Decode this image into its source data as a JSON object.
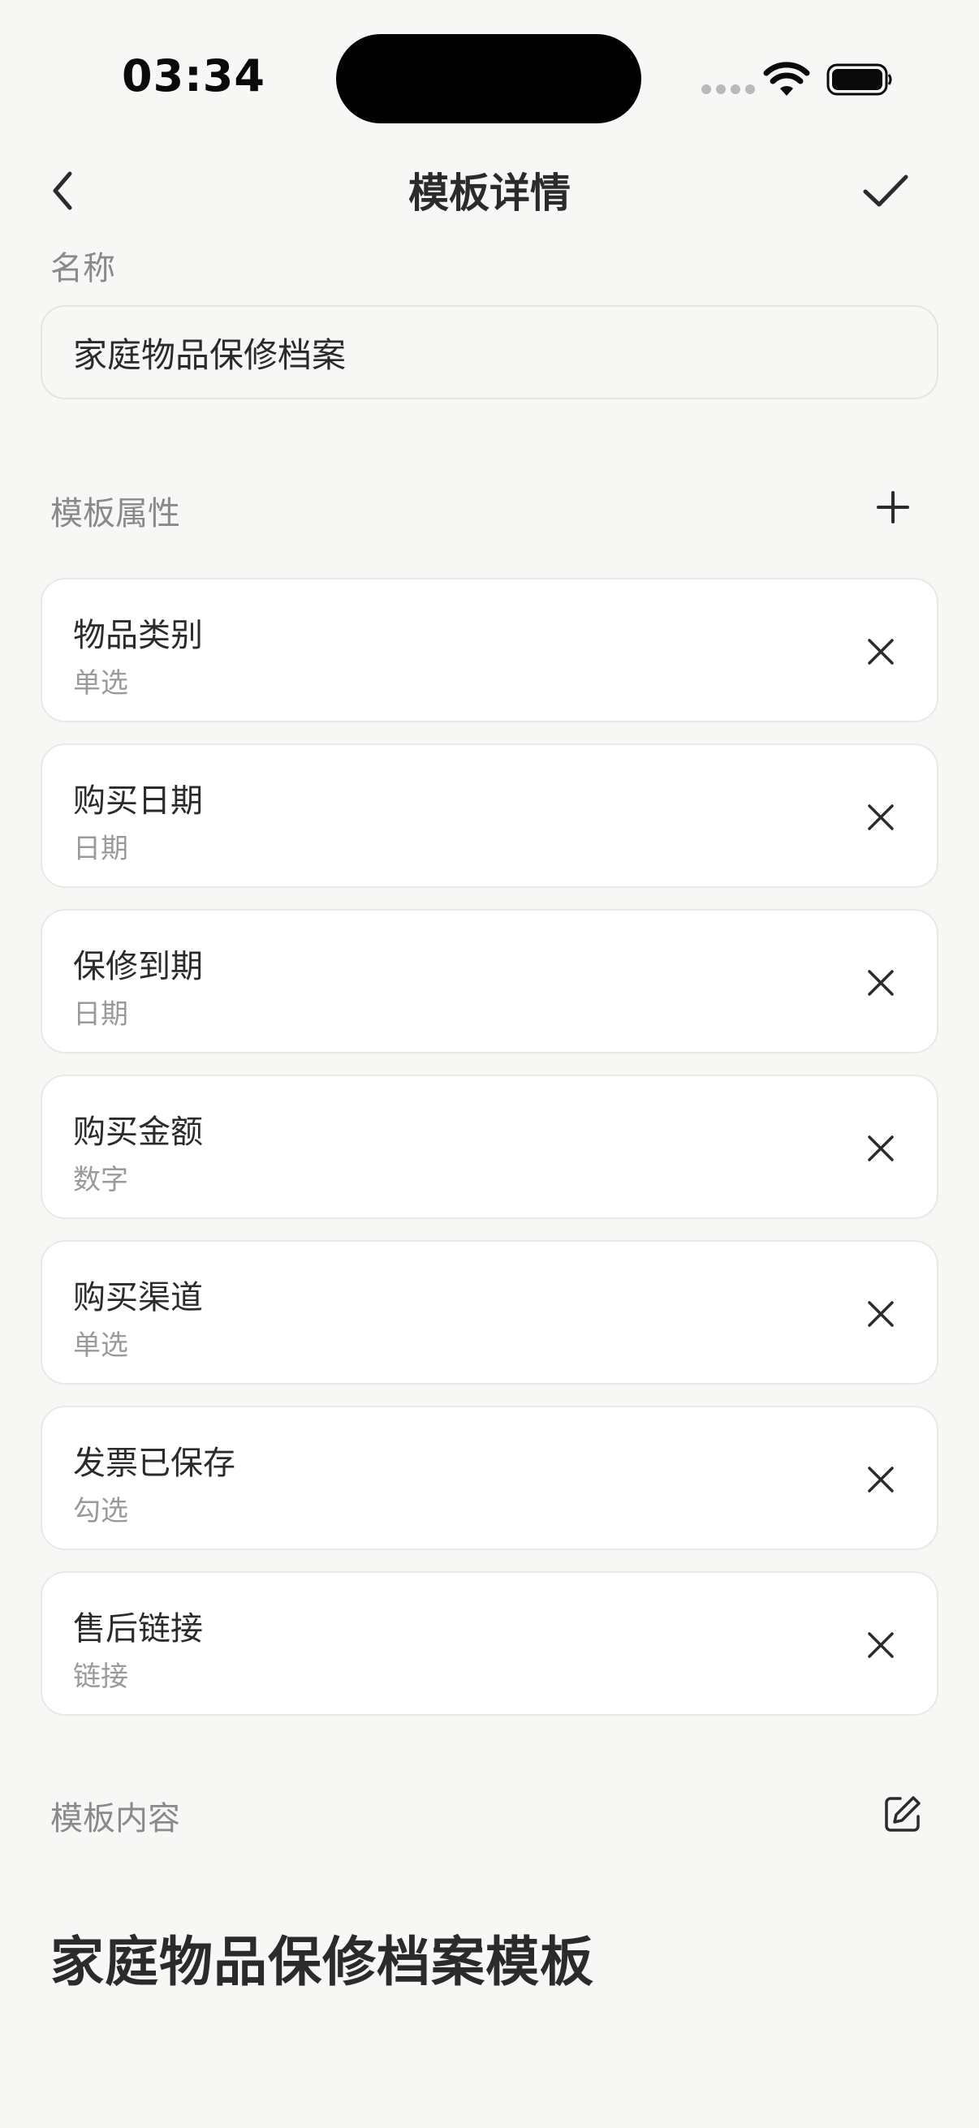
{
  "status_bar": {
    "time": "03:34"
  },
  "nav": {
    "title": "模板详情",
    "back_icon": "chevron-left-icon",
    "confirm_icon": "checkmark-icon"
  },
  "name_section": {
    "label": "名称",
    "value": "家庭物品保修档案"
  },
  "attributes_section": {
    "label": "模板属性",
    "add_icon": "plus-icon",
    "items": [
      {
        "name": "物品类别",
        "type": "单选"
      },
      {
        "name": "购买日期",
        "type": "日期"
      },
      {
        "name": "保修到期",
        "type": "日期"
      },
      {
        "name": "购买金额",
        "type": "数字"
      },
      {
        "name": "购买渠道",
        "type": "单选"
      },
      {
        "name": "发票已保存",
        "type": "勾选"
      },
      {
        "name": "售后链接",
        "type": "链接"
      }
    ]
  },
  "content_section": {
    "label": "模板内容",
    "edit_icon": "edit-icon",
    "heading": "家庭物品保修档案模板"
  }
}
